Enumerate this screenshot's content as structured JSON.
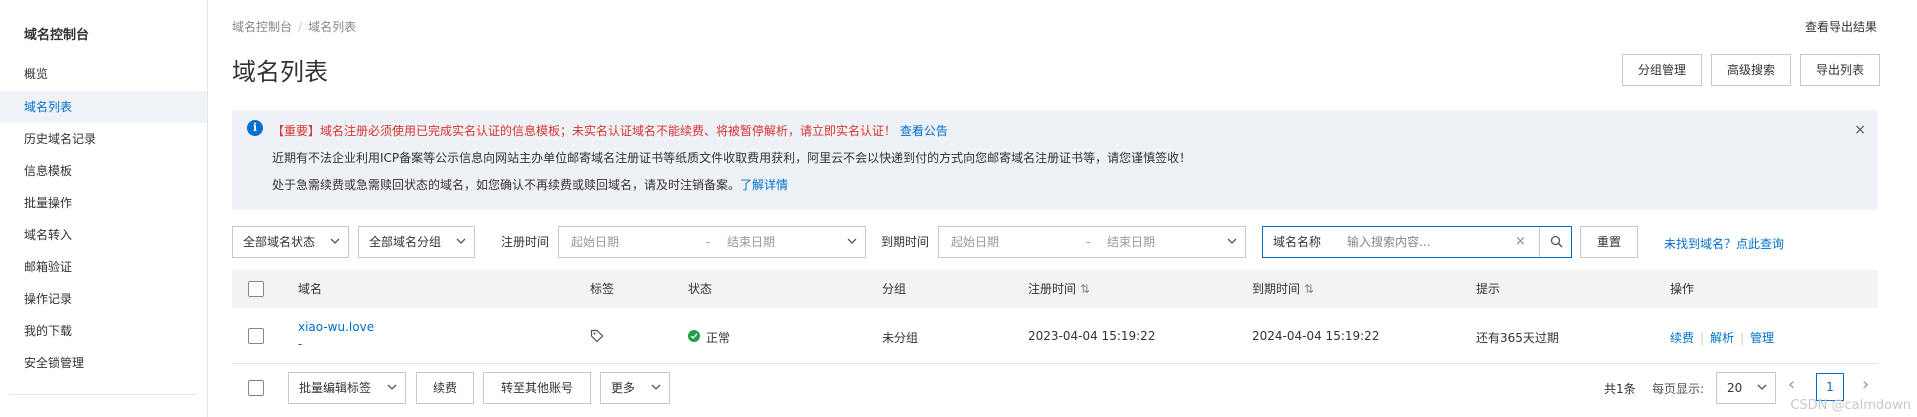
{
  "sidebar": {
    "title": "域名控制台",
    "items": [
      {
        "label": "概览"
      },
      {
        "label": "域名列表"
      },
      {
        "label": "历史域名记录"
      },
      {
        "label": "信息模板"
      },
      {
        "label": "批量操作"
      },
      {
        "label": "域名转入"
      },
      {
        "label": "邮箱验证"
      },
      {
        "label": "操作记录"
      },
      {
        "label": "我的下载"
      },
      {
        "label": "安全锁管理"
      }
    ]
  },
  "header": {
    "breadcrumb": [
      "域名控制台",
      "域名列表"
    ],
    "breadcrumb_sep": "/",
    "title": "域名列表",
    "export_result": "查看导出结果",
    "buttons": {
      "group": "分组管理",
      "advanced": "高级搜索",
      "export": "导出列表"
    }
  },
  "notice": {
    "line1_prefix": "【重要】",
    "line1_text": "域名注册必须使用已完成实名认证的信息模板；未实名认证域名不能续费、将被暂停解析，请立即实名认证！",
    "line1_link": "查看公告",
    "line2": "近期有不法企业利用ICP备案等公示信息向网站主办单位邮寄域名注册证书等纸质文件收取费用获利，阿里云不会以快递到付的方式向您邮寄域名注册证书等，请您谨慎签收！",
    "line3_text": "处于急需续费或急需赎回状态的域名，如您确认不再续费或赎回域名，请及时注销备案。",
    "line3_link": "了解详情",
    "close": "×"
  },
  "filters": {
    "status_select": "全部域名状态",
    "group_select": "全部域名分组",
    "reg_label": "注册时间",
    "exp_label": "到期时间",
    "start_placeholder": "起始日期",
    "range_sep": "-",
    "end_placeholder": "结束日期",
    "search_category": "域名名称",
    "search_placeholder": "输入搜索内容...",
    "search_clear": "×",
    "reset": "重置",
    "not_found_link": "未找到域名？点此查询"
  },
  "table": {
    "columns": {
      "domain": "域名",
      "tag": "标签",
      "status": "状态",
      "group": "分组",
      "reg_time": "注册时间",
      "exp_time": "到期时间",
      "hint": "提示",
      "ops": "操作"
    },
    "sort_glyph": "⇅",
    "rows": [
      {
        "domain": "xiao-wu.love",
        "sub": "-",
        "status": "正常",
        "group": "未分组",
        "reg_time": "2023-04-04 15:19:22",
        "exp_time": "2024-04-04 15:19:22",
        "hint": "还有365天过期",
        "ops": [
          "续费",
          "解析",
          "管理"
        ]
      }
    ]
  },
  "footer": {
    "batch_tag": "批量编辑标签",
    "renew": "续费",
    "transfer": "转至其他账号",
    "more": "更多",
    "total": "共1条",
    "per_page_label": "每页显示:",
    "per_page_value": "20",
    "current_page": "1",
    "prev": "‹",
    "next": "›"
  },
  "watermark": "CSDN @calmdown",
  "colors": {
    "accent": "#0070cc",
    "danger": "#d9352f",
    "success": "#1f9d48",
    "notice_bg": "#eef1f6"
  }
}
